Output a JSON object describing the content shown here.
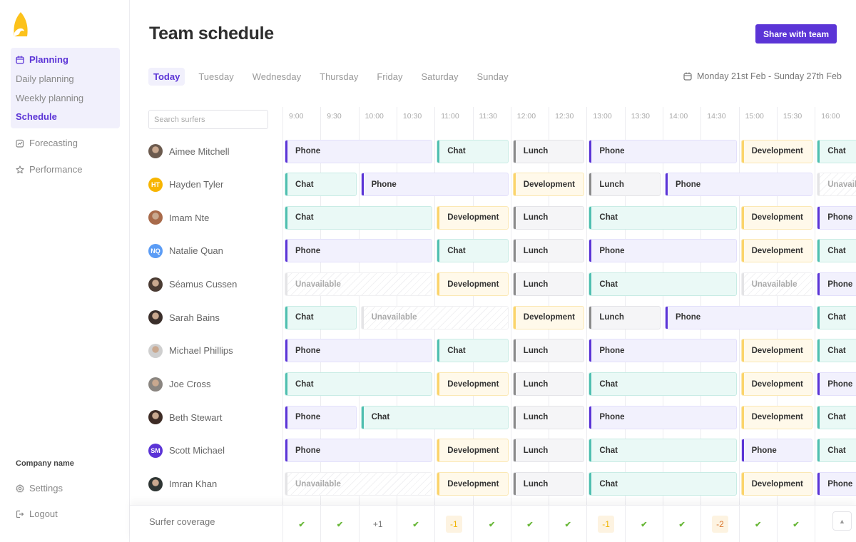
{
  "sidebar": {
    "logo": "surfboard-logo",
    "planning": {
      "label": "Planning",
      "items": [
        {
          "label": "Daily planning",
          "active": false
        },
        {
          "label": "Weekly planning",
          "active": false
        },
        {
          "label": "Schedule",
          "active": true
        }
      ]
    },
    "items": [
      {
        "label": "Forecasting",
        "icon": "chart-icon"
      },
      {
        "label": "Performance",
        "icon": "star-icon"
      }
    ],
    "company_name": "Company name",
    "bottom_items": [
      {
        "label": "Settings",
        "icon": "gear-icon"
      },
      {
        "label": "Logout",
        "icon": "logout-icon"
      }
    ]
  },
  "header": {
    "title": "Team schedule",
    "share_label": "Share with team",
    "date_range": "Monday 21st Feb - Sunday 27th Feb"
  },
  "tabs": [
    {
      "label": "Today",
      "active": true
    },
    {
      "label": "Tuesday",
      "active": false
    },
    {
      "label": "Wednesday",
      "active": false
    },
    {
      "label": "Thursday",
      "active": false
    },
    {
      "label": "Friday",
      "active": false
    },
    {
      "label": "Saturday",
      "active": false
    },
    {
      "label": "Sunday",
      "active": false
    }
  ],
  "search": {
    "placeholder": "Search surfers",
    "value": ""
  },
  "times": [
    "9:00",
    "9:30",
    "10:00",
    "10:30",
    "11:00",
    "11:30",
    "12:00",
    "12:30",
    "13:00",
    "13:30",
    "14:00",
    "14:30",
    "15:00",
    "15:30",
    "16:00"
  ],
  "colors": {
    "accent": "#5b34d6",
    "phone": "#5b34d6",
    "chat": "#4fbfb0",
    "lunch": "#8a8a8a",
    "development": "#fbd46a",
    "unavailable": "#e4e4e6"
  },
  "people": [
    {
      "name": "Aimee Mitchell",
      "avatar": {
        "type": "photo",
        "color": "#6b5a4e"
      },
      "shifts": [
        {
          "type": "Phone",
          "start": "9:00",
          "end": "11:00"
        },
        {
          "type": "Chat",
          "start": "11:00",
          "end": "12:00"
        },
        {
          "type": "Lunch",
          "start": "12:00",
          "end": "13:00"
        },
        {
          "type": "Phone",
          "start": "13:00",
          "end": "15:00"
        },
        {
          "type": "Development",
          "start": "15:00",
          "end": "16:00"
        },
        {
          "type": "Chat",
          "start": "16:00",
          "end": ""
        }
      ]
    },
    {
      "name": "Hayden Tyler",
      "avatar": {
        "type": "initials",
        "initials": "HT",
        "color": "#f7b500"
      },
      "shifts": [
        {
          "type": "Chat",
          "start": "9:00",
          "end": "10:00"
        },
        {
          "type": "Phone",
          "start": "10:00",
          "end": "12:00"
        },
        {
          "type": "Development",
          "start": "12:00",
          "end": "13:00"
        },
        {
          "type": "Lunch",
          "start": "13:00",
          "end": "14:00"
        },
        {
          "type": "Phone",
          "start": "14:00",
          "end": "16:00"
        },
        {
          "type": "Unavailable",
          "start": "16:00",
          "end": ""
        }
      ]
    },
    {
      "name": "Imam Nte",
      "avatar": {
        "type": "photo",
        "color": "#a86a4a"
      },
      "shifts": [
        {
          "type": "Chat",
          "start": "9:00",
          "end": "11:00"
        },
        {
          "type": "Development",
          "start": "11:00",
          "end": "12:00"
        },
        {
          "type": "Lunch",
          "start": "12:00",
          "end": "13:00"
        },
        {
          "type": "Chat",
          "start": "13:00",
          "end": "15:00"
        },
        {
          "type": "Development",
          "start": "15:00",
          "end": "16:00"
        },
        {
          "type": "Phone",
          "start": "16:00",
          "end": ""
        }
      ]
    },
    {
      "name": "Natalie Quan",
      "avatar": {
        "type": "initials",
        "initials": "NQ",
        "color": "#5b9cf5"
      },
      "shifts": [
        {
          "type": "Phone",
          "start": "9:00",
          "end": "11:00"
        },
        {
          "type": "Chat",
          "start": "11:00",
          "end": "12:00"
        },
        {
          "type": "Lunch",
          "start": "12:00",
          "end": "13:00"
        },
        {
          "type": "Phone",
          "start": "13:00",
          "end": "15:00"
        },
        {
          "type": "Development",
          "start": "15:00",
          "end": "16:00"
        },
        {
          "type": "Chat",
          "start": "16:00",
          "end": ""
        }
      ]
    },
    {
      "name": "Séamus Cussen",
      "avatar": {
        "type": "photo",
        "color": "#4a3b33"
      },
      "shifts": [
        {
          "type": "Unavailable",
          "start": "9:00",
          "end": "11:00"
        },
        {
          "type": "Development",
          "start": "11:00",
          "end": "12:00"
        },
        {
          "type": "Lunch",
          "start": "12:00",
          "end": "13:00"
        },
        {
          "type": "Chat",
          "start": "13:00",
          "end": "15:00"
        },
        {
          "type": "Unavailable",
          "start": "15:00",
          "end": "16:00"
        },
        {
          "type": "Phone",
          "start": "16:00",
          "end": ""
        }
      ]
    },
    {
      "name": "Sarah Bains",
      "avatar": {
        "type": "photo",
        "color": "#3a2e2a"
      },
      "shifts": [
        {
          "type": "Chat",
          "start": "9:00",
          "end": "10:00"
        },
        {
          "type": "Unavailable",
          "start": "10:00",
          "end": "12:00"
        },
        {
          "type": "Development",
          "start": "12:00",
          "end": "13:00"
        },
        {
          "type": "Lunch",
          "start": "13:00",
          "end": "14:00"
        },
        {
          "type": "Phone",
          "start": "14:00",
          "end": "16:00"
        },
        {
          "type": "Chat",
          "start": "16:00",
          "end": ""
        }
      ]
    },
    {
      "name": "Michael Phillips",
      "avatar": {
        "type": "photo",
        "color": "#cfcfcf"
      },
      "shifts": [
        {
          "type": "Phone",
          "start": "9:00",
          "end": "11:00"
        },
        {
          "type": "Chat",
          "start": "11:00",
          "end": "12:00"
        },
        {
          "type": "Lunch",
          "start": "12:00",
          "end": "13:00"
        },
        {
          "type": "Phone",
          "start": "13:00",
          "end": "15:00"
        },
        {
          "type": "Development",
          "start": "15:00",
          "end": "16:00"
        },
        {
          "type": "Chat",
          "start": "16:00",
          "end": ""
        }
      ]
    },
    {
      "name": "Joe Cross",
      "avatar": {
        "type": "photo",
        "color": "#8a8580"
      },
      "shifts": [
        {
          "type": "Chat",
          "start": "9:00",
          "end": "11:00"
        },
        {
          "type": "Development",
          "start": "11:00",
          "end": "12:00"
        },
        {
          "type": "Lunch",
          "start": "12:00",
          "end": "13:00"
        },
        {
          "type": "Chat",
          "start": "13:00",
          "end": "15:00"
        },
        {
          "type": "Development",
          "start": "15:00",
          "end": "16:00"
        },
        {
          "type": "Phone",
          "start": "16:00",
          "end": ""
        }
      ]
    },
    {
      "name": "Beth Stewart",
      "avatar": {
        "type": "photo",
        "color": "#3d2b25"
      },
      "shifts": [
        {
          "type": "Phone",
          "start": "9:00",
          "end": "10:00"
        },
        {
          "type": "Chat",
          "start": "10:00",
          "end": "12:00"
        },
        {
          "type": "Lunch",
          "start": "12:00",
          "end": "13:00"
        },
        {
          "type": "Phone",
          "start": "13:00",
          "end": "15:00"
        },
        {
          "type": "Development",
          "start": "15:00",
          "end": "16:00"
        },
        {
          "type": "Chat",
          "start": "16:00",
          "end": ""
        }
      ]
    },
    {
      "name": "Scott Michael",
      "avatar": {
        "type": "initials",
        "initials": "SM",
        "color": "#5b34d6"
      },
      "shifts": [
        {
          "type": "Phone",
          "start": "9:00",
          "end": "11:00"
        },
        {
          "type": "Development",
          "start": "11:00",
          "end": "12:00"
        },
        {
          "type": "Lunch",
          "start": "12:00",
          "end": "13:00"
        },
        {
          "type": "Chat",
          "start": "13:00",
          "end": "15:00"
        },
        {
          "type": "Phone",
          "start": "15:00",
          "end": "16:00"
        },
        {
          "type": "Chat",
          "start": "16:00",
          "end": ""
        }
      ]
    },
    {
      "name": "Imran Khan",
      "avatar": {
        "type": "photo",
        "color": "#2e3533"
      },
      "shifts": [
        {
          "type": "Unavailable",
          "start": "9:00",
          "end": "11:00"
        },
        {
          "type": "Development",
          "start": "11:00",
          "end": "12:00"
        },
        {
          "type": "Lunch",
          "start": "12:00",
          "end": "13:00"
        },
        {
          "type": "Chat",
          "start": "13:00",
          "end": "15:00"
        },
        {
          "type": "Development",
          "start": "15:00",
          "end": "16:00"
        },
        {
          "type": "Phone",
          "start": "16:00",
          "end": ""
        }
      ]
    }
  ],
  "coverage": {
    "label": "Surfer coverage",
    "values": [
      "ok",
      "ok",
      "+1",
      "ok",
      "-1",
      "ok",
      "ok",
      "ok",
      "-1",
      "ok",
      "ok",
      "-2",
      "ok",
      "ok"
    ]
  },
  "scroll_top_icon": "caret-up-icon"
}
